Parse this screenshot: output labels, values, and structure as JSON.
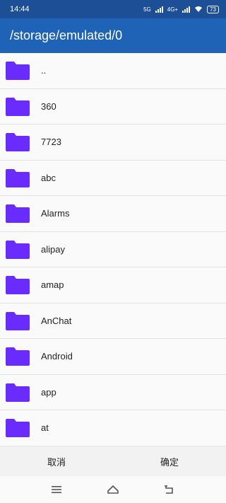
{
  "status_bar": {
    "time": "14:44",
    "network_labels": [
      "5G",
      "4G+"
    ],
    "battery": "73"
  },
  "app_bar": {
    "title": "/storage/emulated/0"
  },
  "folders": [
    {
      "name": ".."
    },
    {
      "name": "360"
    },
    {
      "name": "7723"
    },
    {
      "name": "abc"
    },
    {
      "name": "Alarms"
    },
    {
      "name": "alipay"
    },
    {
      "name": "amap"
    },
    {
      "name": "AnChat"
    },
    {
      "name": "Android"
    },
    {
      "name": "app"
    },
    {
      "name": "at"
    }
  ],
  "actions": {
    "cancel_label": "取消",
    "confirm_label": "确定"
  },
  "colors": {
    "status_bar": "#1c4f96",
    "app_bar": "#1e63b5",
    "folder_icon": "#6a2bff"
  },
  "icons": {
    "folder": "folder-icon",
    "nav_menu": "menu-icon",
    "nav_home": "home-icon",
    "nav_back": "back-icon"
  }
}
